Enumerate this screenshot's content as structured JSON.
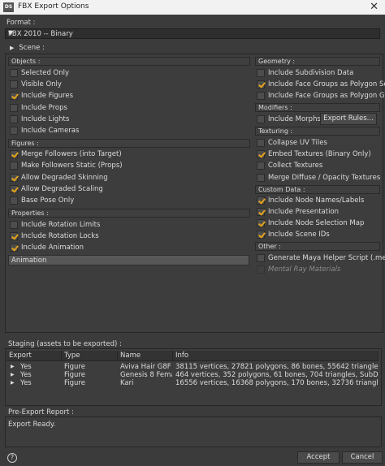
{
  "window": {
    "icon": "DS",
    "title": "FBX Export Options",
    "close": "✕"
  },
  "format": {
    "label": "Format :",
    "selected": "FBX 2010 -- Binary"
  },
  "scene": {
    "label": "Scene :"
  },
  "objects": {
    "header": "Objects :",
    "items": [
      {
        "label": "Selected Only",
        "checked": false
      },
      {
        "label": "Visible Only",
        "checked": false
      },
      {
        "label": "Include Figures",
        "checked": true
      },
      {
        "label": "Include Props",
        "checked": false
      },
      {
        "label": "Include Lights",
        "checked": false
      },
      {
        "label": "Include Cameras",
        "checked": false
      }
    ]
  },
  "figures": {
    "header": "Figures :",
    "items": [
      {
        "label": "Merge Followers (into Target)",
        "checked": true
      },
      {
        "label": "Make Followers Static (Props)",
        "checked": false
      },
      {
        "label": "Allow Degraded Skinning",
        "checked": true
      },
      {
        "label": "Allow Degraded Scaling",
        "checked": true
      },
      {
        "label": "Base Pose Only",
        "checked": false
      }
    ]
  },
  "properties": {
    "header": "Properties :",
    "items": [
      {
        "label": "Include Rotation Limits",
        "checked": false
      },
      {
        "label": "Include Rotation Locks",
        "checked": true
      },
      {
        "label": "Include Animation",
        "checked": true
      }
    ],
    "animation_label": "Animation"
  },
  "geometry": {
    "header": "Geometry :",
    "items": [
      {
        "label": "Include Subdivision Data",
        "checked": false
      },
      {
        "label": "Include Face Groups as Polygon Sets",
        "checked": true
      },
      {
        "label": "Include Face Groups as Polygon Groups",
        "checked": false
      }
    ]
  },
  "modifiers": {
    "header": "Modifiers :",
    "items": [
      {
        "label": "Include Morphs",
        "checked": false
      }
    ],
    "export_rules": "Export Rules..."
  },
  "texturing": {
    "header": "Texturing :",
    "items": [
      {
        "label": "Collapse UV Tiles",
        "checked": false
      },
      {
        "label": "Embed Textures (Binary Only)",
        "checked": true
      },
      {
        "label": "Collect Textures",
        "checked": false
      },
      {
        "label": "Merge Diffuse / Opacity Textures",
        "checked": false
      }
    ]
  },
  "custom_data": {
    "header": "Custom Data :",
    "items": [
      {
        "label": "Include Node Names/Labels",
        "checked": true
      },
      {
        "label": "Include Presentation",
        "checked": true
      },
      {
        "label": "Include Node Selection Map",
        "checked": true
      },
      {
        "label": "Include Scene IDs",
        "checked": true
      }
    ]
  },
  "other": {
    "header": "Other :",
    "items": [
      {
        "label": "Generate Maya Helper Script (.mel)",
        "checked": false
      },
      {
        "label": "Mental Ray Materials",
        "checked": false,
        "disabled": true
      }
    ]
  },
  "staging": {
    "label": "Staging (assets to be exported) :",
    "columns": [
      "Export",
      "Type",
      "Name",
      "Info"
    ],
    "rows": [
      {
        "expand": "▶",
        "export": "Yes",
        "type": "Figure",
        "name": "Aviva Hair G8F",
        "info": "38115 vertices, 27821 polygons, 86 bones, 55642 triangles"
      },
      {
        "expand": "▶",
        "export": "Yes",
        "type": "Figure",
        "name": "Genesis 8 Femal...",
        "info": "464 vertices, 352 polygons, 61 bones, 704 triangles, SubD Cage"
      },
      {
        "expand": "▶",
        "export": "Yes",
        "type": "Figure",
        "name": "Kari",
        "info": "16556 vertices, 16368 polygons, 170 bones, 32736 triangles, SubD Cage"
      }
    ]
  },
  "report": {
    "label": "Pre-Export Report :",
    "text": "Export Ready."
  },
  "footer": {
    "help": "?",
    "accept": "Accept",
    "cancel": "Cancel"
  },
  "colors": {
    "check": "#e3a21a",
    "background": "#3b3b3b"
  }
}
